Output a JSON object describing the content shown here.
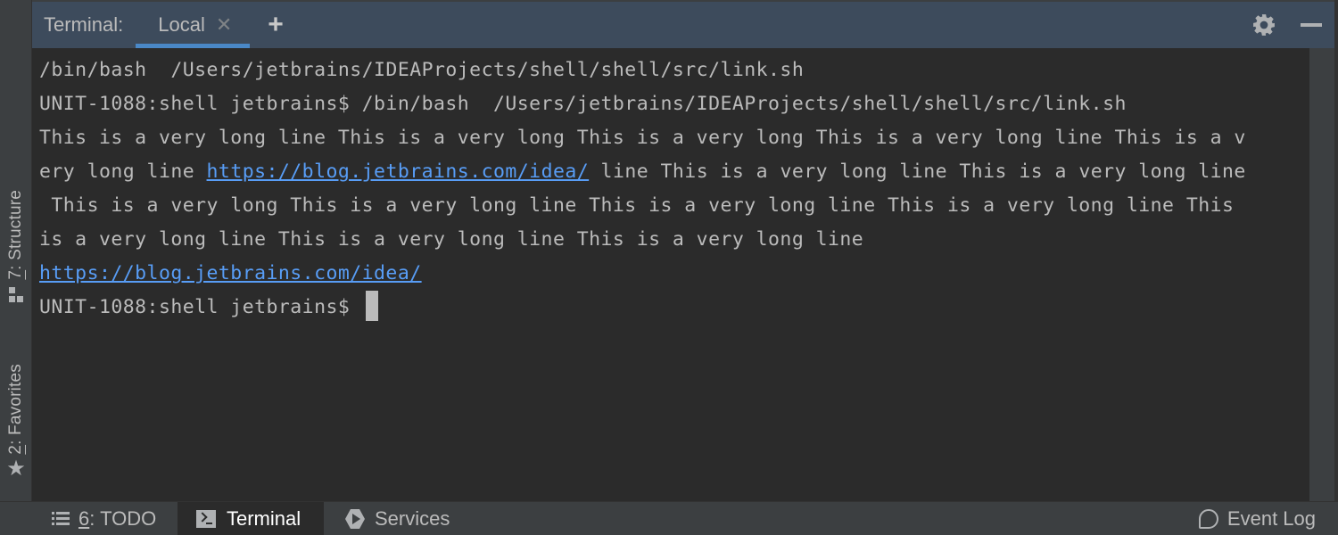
{
  "left_strip": {
    "structure": {
      "mnemonic": "7",
      "label": ": Structure",
      "icon": "structure-icon"
    },
    "favorites": {
      "mnemonic": "2",
      "label": ": Favorites",
      "icon": "star-icon"
    }
  },
  "header": {
    "title": "Terminal:",
    "tabs": [
      {
        "label": "Local",
        "close_icon": "✕",
        "active": true
      }
    ],
    "add_icon": "+",
    "settings_icon": "gear-icon",
    "minimize_icon": "minimize-icon"
  },
  "terminal": {
    "lines": [
      "/bin/bash  /Users/jetbrains/IDEAProjects/shell/shell/src/link.sh",
      "UNIT-1088:shell jetbrains$ /bin/bash  /Users/jetbrains/IDEAProjects/shell/shell/src/link.sh",
      "This is a very long line This is a very long This is a very long This is a very long line This is a v"
    ],
    "line4_prefix": "ery long line ",
    "link_url": "https://blog.jetbrains.com/idea/",
    "line4_suffix": " line This is a very long line This is a very long line",
    "line5": " This is a very long This is a very long line This is a very long line This is a very long line This",
    "line6": "is a very long line This is a very long line This is a very long line",
    "prompt": "UNIT-1088:shell jetbrains$ ",
    "link_color": "#589df6"
  },
  "bottombar": {
    "todo": {
      "mnemonic": "6",
      "label": ": TODO"
    },
    "terminal": {
      "label": "Terminal",
      "active": true
    },
    "services": {
      "label": "Services"
    },
    "event_log": {
      "label": "Event Log"
    }
  },
  "colors": {
    "header_bg": "#3d4b5c",
    "active_tab_underline": "#4a88c7",
    "terminal_bg": "#2b2b2b",
    "text": "#bbbbbb"
  }
}
